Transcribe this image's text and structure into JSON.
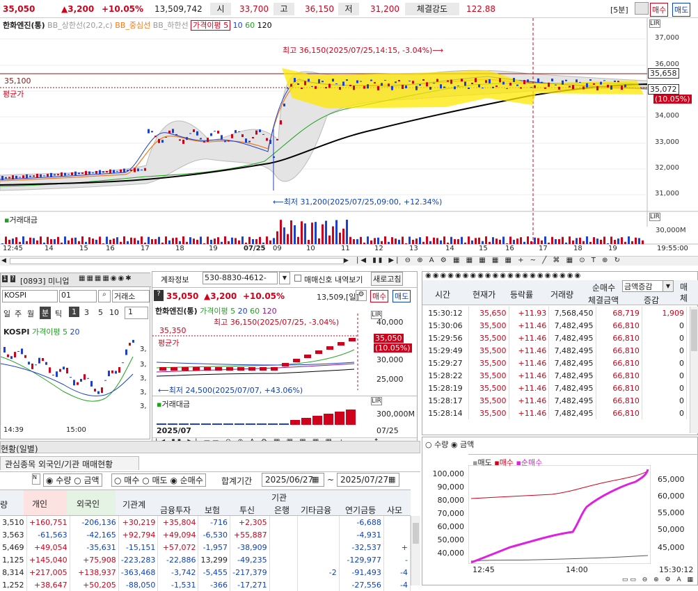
{
  "header": {
    "price": "35,050",
    "change": "▲3,200",
    "pct": "+10.05%",
    "volume": "13,509,742",
    "open_label": "시",
    "open": "33,700",
    "high_label": "고",
    "high": "36,150",
    "low_label": "저",
    "low": "31,200",
    "strength_label": "체결강도",
    "strength": "122.88",
    "interval": "[5분]",
    "buy": "매수",
    "sell": "매도"
  },
  "main": {
    "stock": "한화엔진(통)",
    "legend": [
      "BB_상한선(20,2,c)",
      "BB_중심선",
      "BB_하한선",
      "가격이평 5",
      "10",
      "60",
      "120"
    ],
    "high_note": "최고 36,150(2025/07/25,14:15, -3.04%)⟶",
    "low_note": "⟵최저 31,200(2025/07/25,09:00, +12.34%)",
    "ref_price": "35,100",
    "avg_label": "평균가",
    "y_ticks": [
      "37,000",
      "36,000",
      "35,000",
      "34,000",
      "33,000",
      "32,000",
      "31,000"
    ],
    "tag_hi": "35,658",
    "tag_cur": "35,072",
    "tag_pct": "(10.05%)",
    "vol_title": "거래대금",
    "vol_ticks": [
      "30,000M"
    ],
    "x_ticks": [
      "12:45",
      "14",
      "15",
      "16",
      "17",
      "18",
      "19",
      "07/25",
      "09",
      "10",
      "11",
      "12",
      "13",
      "14",
      "15",
      "16",
      "17",
      "18",
      "19",
      "19:55:00"
    ]
  },
  "mini": {
    "code_title": "[0893] 미니업",
    "code": "KOSPI",
    "code2": "01",
    "market": "거래소",
    "tabs": [
      "일",
      "주",
      "월",
      "분",
      "틱",
      "1",
      "3",
      "5",
      "10",
      "1"
    ],
    "chart_title": "KOSPI",
    "legend": [
      "가격이평 5",
      "20"
    ],
    "x_ticks": [
      "14:39",
      "15:00"
    ],
    "label_acct": "계좌정보",
    "y_vals": [
      "3,",
      "3,",
      "3,",
      "3,",
      "3,"
    ]
  },
  "acct": {
    "acct_no": "530-8830-4612-",
    "signal": "매매신호 내역보기",
    "refresh": "새로고침",
    "buy": "매수",
    "sell": "매도",
    "stock": "한화엔진(통)",
    "price": "35,050",
    "change": "▲3,200",
    "pct": "+10.05%",
    "volume": "13,509,[일]",
    "legend": [
      "가격이평 5",
      "20",
      "60",
      "120"
    ],
    "high_note": "최고 36,150(2025/07/25, -3.04%)",
    "low_note": "⟵최저 24,500(2025/07/07, +43.06%)",
    "ref": "35,350",
    "avg": "평균가",
    "y_ticks": [
      "40,000",
      "30,000",
      "25,000"
    ],
    "tag1": "35,050",
    "tag2": "(10.05%)",
    "vol_title": "거래대금",
    "vol_tick": "300,000M",
    "x_left": "2025/07",
    "x_right": "07/25"
  },
  "ticks_table": {
    "headers": [
      "시간",
      "현재가",
      "등락률",
      "거래량",
      "순매수",
      "체결금액",
      "증감"
    ],
    "filter": "금액증감",
    "extra": "매체",
    "rows": [
      [
        "15:30:12",
        "35,650",
        "+11.93",
        "7,568,450",
        "68,719",
        "1,909"
      ],
      [
        "15:30:06",
        "35,500",
        "+11.46",
        "7,482,495",
        "66,810",
        "0"
      ],
      [
        "15:29:56",
        "35,500",
        "+11.46",
        "7,482,495",
        "66,810",
        "0"
      ],
      [
        "15:29:49",
        "35,500",
        "+11.46",
        "7,482,495",
        "66,810",
        "0"
      ],
      [
        "15:29:27",
        "35,500",
        "+11.46",
        "7,482,495",
        "66,810",
        "0"
      ],
      [
        "15:28:22",
        "35,500",
        "+11.46",
        "7,482,495",
        "66,810",
        "0"
      ],
      [
        "15:28:19",
        "35,500",
        "+11.46",
        "7,482,495",
        "66,810",
        "0"
      ],
      [
        "15:28:17",
        "35,500",
        "+11.46",
        "7,482,495",
        "66,810",
        "0"
      ],
      [
        "15:28:14",
        "35,500",
        "+11.46",
        "7,482,495",
        "66,810",
        "0"
      ]
    ]
  },
  "flow": {
    "radio": [
      "수량",
      "금액"
    ],
    "legend": [
      "매도",
      "매수",
      "순매수"
    ],
    "y_left": [
      "100,000",
      "90,000",
      "80,000",
      "70,000",
      "60,000",
      "50,000",
      "40,000"
    ],
    "y_right": [
      "65,000",
      "60,000",
      "55,000",
      "50,000",
      "45,000"
    ],
    "x": [
      "12:45",
      "14:00",
      "15:30:12"
    ]
  },
  "investor": {
    "title": "현황(일별)",
    "tab": "관심종목 외국인/기관 매매현황",
    "opts": [
      "수량",
      "금액",
      "매수",
      "매도",
      "순매수"
    ],
    "period_label": "합계기간",
    "from": "2025/06/27",
    "to": "2025/07/27",
    "group": "기관",
    "headers": [
      "량",
      "개인",
      "외국인",
      "기관계",
      "금융투자",
      "보험",
      "투신",
      "은행",
      "기타금융",
      "연기금등",
      "사모"
    ],
    "rows": [
      [
        "3,510",
        "+160,751",
        "-206,136",
        "+30,219",
        "+35,804",
        "-716",
        "+2,305",
        "",
        "",
        "-6,688",
        ""
      ],
      [
        "3,563",
        "-61,563",
        "-42,165",
        "+92,794",
        "+49,094",
        "-6,530",
        "+55,887",
        "",
        "",
        "-4,931",
        ""
      ],
      [
        "5,469",
        "+49,054",
        "-35,631",
        "-15,151",
        "+57,072",
        "-1,957",
        "-38,909",
        "",
        "",
        "-32,537",
        "+"
      ],
      [
        "1,125",
        "+145,040",
        "+75,908",
        "-223,283",
        "-22,886",
        "13,299",
        "-49,235",
        "",
        "",
        "-129,977",
        "-"
      ],
      [
        "8,314",
        "+217,005",
        "+138,937",
        "-363,468",
        "-3,742",
        "-5,455",
        "-217,379",
        "",
        "-2",
        "-91,493",
        "-4"
      ],
      [
        "1,252",
        "+38,647",
        "+50,205",
        "-88,050",
        "-1,531",
        "-366",
        "-17,271",
        "",
        "",
        "-27,556",
        "-4"
      ]
    ]
  }
}
